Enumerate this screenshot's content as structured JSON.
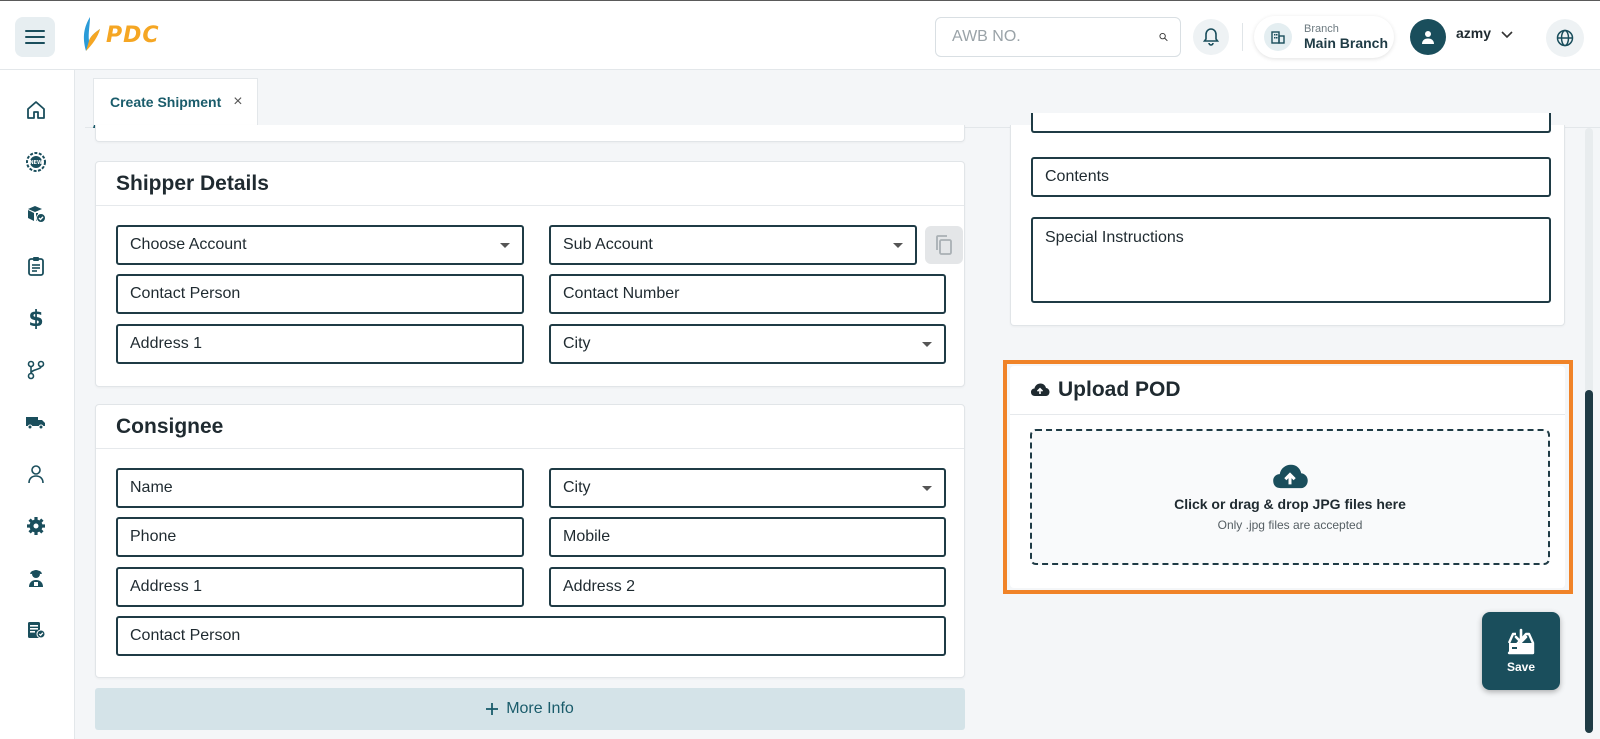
{
  "header": {
    "logo_text": "PDC",
    "search_placeholder": "AWB NO.",
    "branch_label": "Branch",
    "branch_name": "Main Branch",
    "username": "azmy"
  },
  "sidebar": {
    "items": [
      {
        "icon": "home-icon"
      },
      {
        "icon": "new-badge-icon"
      },
      {
        "icon": "packages-icon"
      },
      {
        "icon": "clipboard-icon"
      },
      {
        "icon": "dollar-icon"
      },
      {
        "icon": "branch-icon"
      },
      {
        "icon": "truck-icon"
      },
      {
        "icon": "user-icon"
      },
      {
        "icon": "gear-icon"
      },
      {
        "icon": "agent-icon"
      },
      {
        "icon": "report-icon"
      }
    ]
  },
  "tabs": [
    {
      "label": "Create Shipment",
      "close": "×"
    }
  ],
  "shipper": {
    "title": "Shipper Details",
    "choose_account": "Choose Account",
    "sub_account": "Sub Account",
    "contact_person": "Contact Person",
    "contact_number": "Contact Number",
    "address1": "Address 1",
    "city": "City"
  },
  "consignee": {
    "title": "Consignee",
    "name": "Name",
    "city": "City",
    "phone": "Phone",
    "mobile": "Mobile",
    "address1": "Address 1",
    "address2": "Address 2",
    "contact_person": "Contact Person"
  },
  "details": {
    "contents": "Contents",
    "special_instructions": "Special Instructions"
  },
  "upload": {
    "title": "Upload POD",
    "main_text": "Click or drag & drop JPG files here",
    "sub_text": "Only .jpg files are accepted"
  },
  "more_info": "More Info",
  "save_label": "Save",
  "colors": {
    "primary": "#1a4e5c",
    "accent": "#f5a623",
    "highlight": "#f08328"
  }
}
